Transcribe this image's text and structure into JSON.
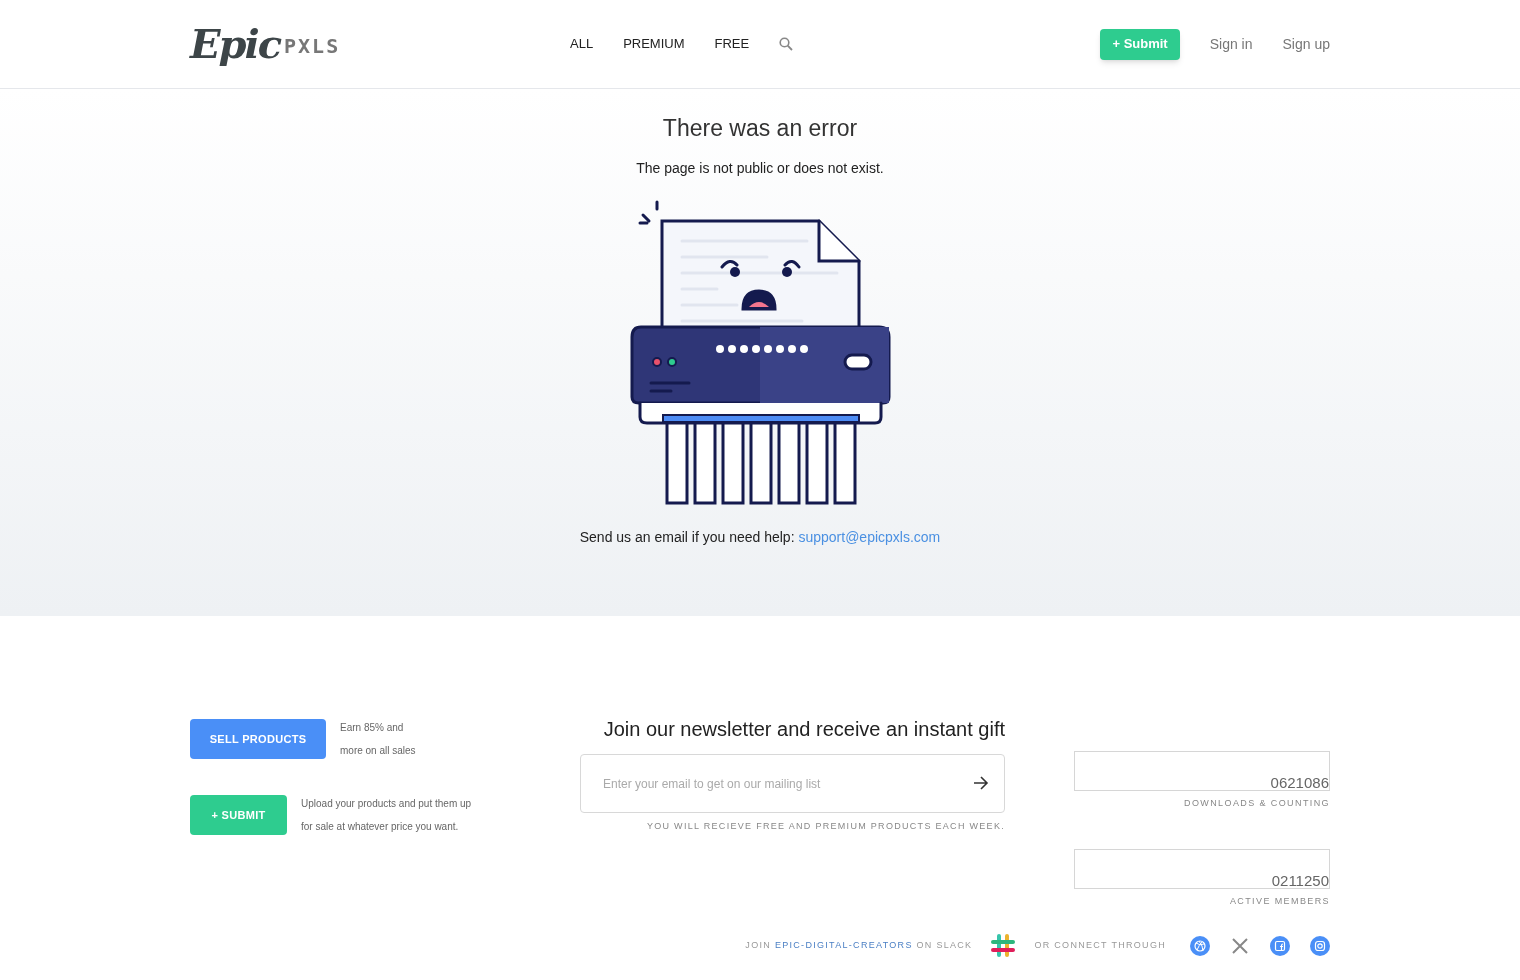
{
  "header": {
    "logo": {
      "script": "Epic",
      "pixel": "PXLS"
    },
    "nav": [
      {
        "label": "ALL"
      },
      {
        "label": "PREMIUM"
      },
      {
        "label": "FREE"
      }
    ],
    "submit": "+ Submit",
    "sign_in": "Sign in",
    "sign_up": "Sign up"
  },
  "error": {
    "title": "There was an error",
    "message": "The page is not public or does not exist.",
    "help_prefix": "Send us an email if you need help:",
    "help_email": "support@epicpxls.com"
  },
  "footer": {
    "actions": [
      {
        "kind": "sell",
        "button": "SELL PRODUCTS",
        "lines": [
          "Earn 85% and",
          "more on all sales"
        ]
      },
      {
        "kind": "submit",
        "button": "+ SUBMIT",
        "lines": [
          "Upload your products and put them up",
          "for sale at whatever price you want."
        ]
      }
    ],
    "newsletter": {
      "title": "Join our newsletter and receive an instant gift",
      "placeholder": "Enter your email to get on our mailing list",
      "note": "YOU WILL RECIEVE FREE AND PREMIUM PRODUCTS EACH WEEK."
    },
    "stats": [
      {
        "value": "0621086",
        "label": "DOWNLOADS & COUNTING"
      },
      {
        "value": "0211250",
        "label": "ACTIVE MEMBERS"
      }
    ],
    "slack": {
      "prefix": "JOIN",
      "link": "EPIC-DIGITAL-CREATORS",
      "suffix": "ON SLACK"
    },
    "connect": "OR CONNECT THROUGH",
    "social": [
      {
        "kind": "dribbble"
      },
      {
        "kind": "x"
      },
      {
        "kind": "facebook"
      },
      {
        "kind": "instagram"
      }
    ]
  }
}
